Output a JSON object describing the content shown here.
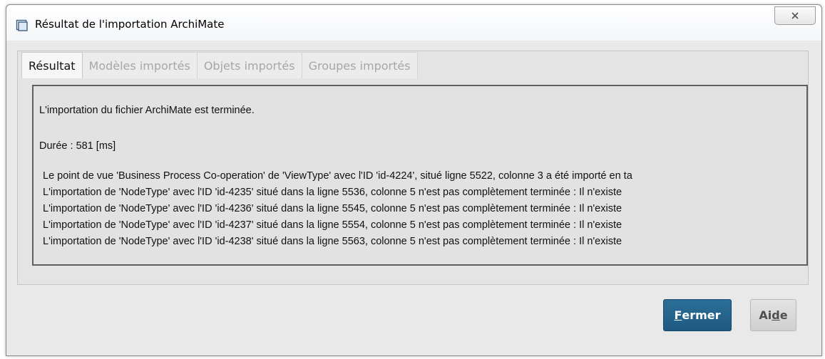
{
  "window": {
    "title": "Résultat de l'importation ArchiMate"
  },
  "tabs": [
    {
      "label": "Résultat",
      "active": true
    },
    {
      "label": "Modèles importés",
      "active": false
    },
    {
      "label": "Objets importés",
      "active": false
    },
    {
      "label": "Groupes importés",
      "active": false
    }
  ],
  "result": {
    "summary": "L'importation du fichier ArchiMate est terminée.",
    "duration": "Durée : 581 [ms]",
    "log": [
      "Le point de vue 'Business Process Co-operation' de 'ViewType' avec l'ID 'id-4224', situé ligne 5522, colonne 3 a été importé en ta",
      "L'importation de 'NodeType' avec l'ID 'id-4235' situé dans la ligne 5536, colonne 5 n'est pas complètement terminée : Il n'existe",
      "L'importation de 'NodeType' avec l'ID 'id-4236' situé dans la ligne 5545, colonne 5 n'est pas complètement terminée : Il n'existe",
      "L'importation de 'NodeType' avec l'ID 'id-4237' situé dans la ligne 5554, colonne 5 n'est pas complètement terminée : Il n'existe",
      "L'importation de 'NodeType' avec l'ID 'id-4238' situé dans la ligne 5563, colonne 5 n'est pas complètement terminée : Il n'existe"
    ]
  },
  "buttons": {
    "close_prefix": "F",
    "close_rest": "ermer",
    "help_prefix": "Ai",
    "help_mnemonic": "d",
    "help_rest": "e"
  },
  "colors": {
    "primary_button": "#1e5a82",
    "content_border": "#5f5f5f"
  }
}
